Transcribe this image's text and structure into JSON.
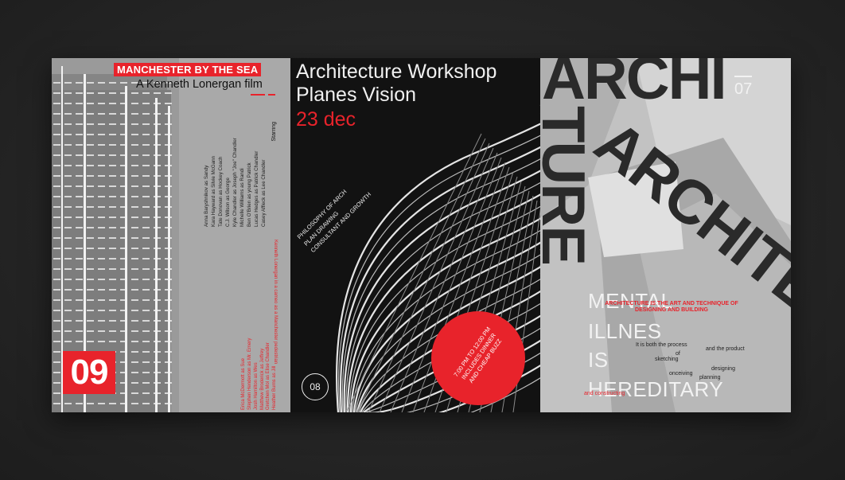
{
  "panel1": {
    "title": "MANCHESTER BY THE SEA",
    "subtitle": "A Kenneth Lonergan film",
    "starring_label": "Starring",
    "cast": [
      "Casey Affleck as Lee Chandler",
      "Lucas Hedges as Patrick Chandler",
      "Ben O'Brien as young Patrick",
      "Michelle Williams as Randi",
      "Kyle Chandler as Joseph \"Joe\" Chandler",
      "C.J. Wilson as George",
      "Tate Donovan as Hockey Coach",
      "Kara Hayward as Silvie McGann",
      "Anna Baryshnikov as Sandy"
    ],
    "red_cast": [
      "Heather Burns as Jill",
      "Gretchen Mol as Elise Chandler",
      "Matthew Broderick as Jeffrey",
      "Josh Hamilton as Wes",
      "Stephen Henderson as Mr. Emery",
      "Erica McDermott as Sue"
    ],
    "cameo_note": "Kenneth Lonergan in a cameo as a Manchester pedestrian",
    "number": "09"
  },
  "panel2": {
    "title_line1": "Architecture Workshop",
    "title_line2": "Planes Vision",
    "date": "23 dec",
    "diagonal_lines": [
      "PHILOSOPHY OF ARCH",
      "PLAN DRAWING",
      "CONSULTANT AND GROWTH"
    ],
    "circle_lines": [
      "7:00 PM TO 12:00 PM",
      "INCLUDES DINNER",
      "AND CHEAP BUZZ"
    ],
    "number": "08"
  },
  "panel3": {
    "big_word_1": "ARCHI",
    "big_word_2": "TURE",
    "big_word_3": "ARCHITEC",
    "number": "07",
    "m_line1": "MENTAL",
    "m_line2": "ILLNES",
    "m_line3": "IS",
    "m_line4": "HEREDITARY",
    "art_definition": "ARCHITECTURE IS THE ART AND TECHNIQUE OF DESIGNING AND BUILDING",
    "small_words": [
      "It is both the process",
      "and the product",
      "of",
      "sketching",
      "designing",
      "onceiving",
      "planning"
    ],
    "constructing": "and constructing"
  },
  "colors": {
    "accent": "#e8232b",
    "background": "#262626"
  }
}
